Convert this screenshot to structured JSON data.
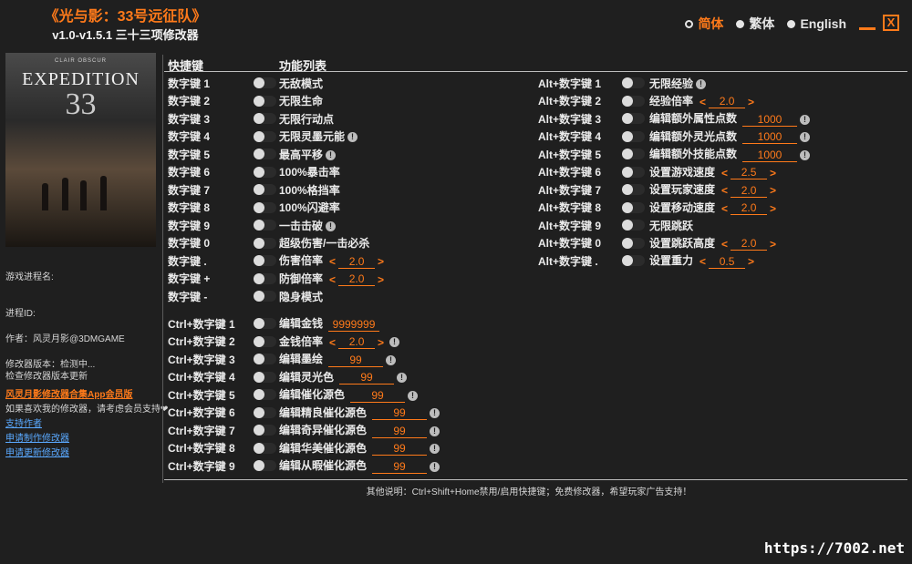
{
  "app": {
    "title": "《光与影：33号远征队》",
    "version": "v1.0-v1.5.1 三十三项修改器"
  },
  "languages": [
    {
      "label": "简体",
      "active": true
    },
    {
      "label": "繁体",
      "active": false
    },
    {
      "label": "English",
      "active": false
    }
  ],
  "window": {
    "minimize": "_",
    "close": "X"
  },
  "cover": {
    "studio": "CLAIR OBSCUR",
    "name": "EXPEDITION",
    "number": "33"
  },
  "headers": {
    "hotkey": "快捷键",
    "features": "功能列表"
  },
  "sidebar": {
    "process_name": "游戏进程名:",
    "process_id": "进程ID:",
    "author": "作者：风灵月影@3DMGAME",
    "version_status": "修改器版本：检测中...",
    "check_update": "检查修改器版本更新",
    "promo": "风灵月影修改器合集App会员版",
    "support_text": "如果喜欢我的修改器，请考虑会员支持❤",
    "links": [
      "支持作者",
      "申请制作修改器",
      "申请更新修改器"
    ]
  },
  "footer": "其他说明：Ctrl+Shift+Home禁用/启用快捷键；免费修改器，希望玩家广告支持！",
  "watermark": "https://7002.net",
  "left_cheats": [
    {
      "key": "数字键 1",
      "label": "无敌模式"
    },
    {
      "key": "数字键 2",
      "label": "无限生命"
    },
    {
      "key": "数字键 3",
      "label": "无限行动点"
    },
    {
      "key": "数字键 4",
      "label": "无限灵墨元能",
      "info": "!"
    },
    {
      "key": "数字键 5",
      "label": "最高平移",
      "info": "!"
    },
    {
      "key": "数字键 6",
      "label": "100%暴击率"
    },
    {
      "key": "数字键 7",
      "label": "100%格挡率"
    },
    {
      "key": "数字键 8",
      "label": "100%闪避率"
    },
    {
      "key": "数字键 9",
      "label": "一击击破",
      "info": "!"
    },
    {
      "key": "数字键 0",
      "label": "超级伤害/一击必杀"
    },
    {
      "key": "数字键 .",
      "label": "伤害倍率",
      "stepper": "2.0"
    },
    {
      "key": "数字键 +",
      "label": "防御倍率",
      "stepper": "2.0"
    },
    {
      "key": "数字键 -",
      "label": "隐身模式"
    }
  ],
  "ctrl_cheats": [
    {
      "key": "Ctrl+数字键 1",
      "label": "编辑金钱",
      "field": "9999999"
    },
    {
      "key": "Ctrl+数字键 2",
      "label": "金钱倍率",
      "stepper": "2.0",
      "info": "!"
    },
    {
      "key": "Ctrl+数字键 3",
      "label": "编辑墨绘",
      "field": "99",
      "info": "!"
    },
    {
      "key": "Ctrl+数字键 4",
      "label": "编辑灵光色",
      "field": "99",
      "info": "!"
    },
    {
      "key": "Ctrl+数字键 5",
      "label": "编辑催化源色",
      "field": "99",
      "info": "!"
    },
    {
      "key": "Ctrl+数字键 6",
      "label": "编辑精良催化源色",
      "field": "99",
      "info": "!"
    },
    {
      "key": "Ctrl+数字键 7",
      "label": "编辑奇异催化源色",
      "field": "99",
      "info": "!"
    },
    {
      "key": "Ctrl+数字键 8",
      "label": "编辑华美催化源色",
      "field": "99",
      "info": "!"
    },
    {
      "key": "Ctrl+数字键 9",
      "label": "编辑从暇催化源色",
      "field": "99",
      "info": "!"
    }
  ],
  "alt_cheats": [
    {
      "key": "Alt+数字键 1",
      "label": "无限经验",
      "info": "!"
    },
    {
      "key": "Alt+数字键 2",
      "label": "经验倍率",
      "stepper": "2.0"
    },
    {
      "key": "Alt+数字键 3",
      "label": "编辑额外属性点数",
      "field": "1000",
      "info": "!"
    },
    {
      "key": "Alt+数字键 4",
      "label": "编辑额外灵光点数",
      "field": "1000",
      "info": "!"
    },
    {
      "key": "Alt+数字键 5",
      "label": "编辑额外技能点数",
      "field": "1000",
      "info": "!"
    },
    {
      "key": "Alt+数字键 6",
      "label": "设置游戏速度",
      "stepper": "2.5"
    },
    {
      "key": "Alt+数字键 7",
      "label": "设置玩家速度",
      "stepper": "2.0"
    },
    {
      "key": "Alt+数字键 8",
      "label": "设置移动速度",
      "stepper": "2.0"
    },
    {
      "key": "Alt+数字键 9",
      "label": "无限跳跃"
    },
    {
      "key": "Alt+数字键 0",
      "label": "设置跳跃高度",
      "stepper": "2.0"
    },
    {
      "key": "Alt+数字键 .",
      "label": "设置重力",
      "stepper": "0.5"
    }
  ]
}
